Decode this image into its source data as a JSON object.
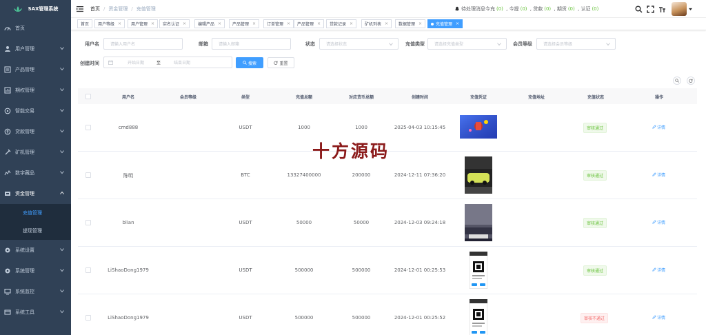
{
  "app": {
    "title": "SAX管理系统"
  },
  "sidebar": {
    "items": [
      {
        "label": "首页",
        "icon": "dashboard-icon"
      },
      {
        "label": "用户管理",
        "icon": "user-icon"
      },
      {
        "label": "产品管理",
        "icon": "product-icon"
      },
      {
        "label": "期权管理",
        "icon": "option-icon"
      },
      {
        "label": "智能交易",
        "icon": "smart-trade-icon"
      },
      {
        "label": "贷款管理",
        "icon": "loan-icon"
      },
      {
        "label": "矿机管理",
        "icon": "miner-icon"
      },
      {
        "label": "数字藏品",
        "icon": "collection-icon"
      },
      {
        "label": "资金管理",
        "icon": "money-icon"
      },
      {
        "label": "系统设置",
        "icon": "settings-icon"
      },
      {
        "label": "系统管理",
        "icon": "system-icon"
      },
      {
        "label": "系统监控",
        "icon": "monitor-icon"
      },
      {
        "label": "系统工具",
        "icon": "tool-icon"
      }
    ],
    "sub_items": [
      "充值管理",
      "提现管理"
    ]
  },
  "breadcrumb": {
    "home": "首页",
    "parent": "资金管理",
    "current": "充值管理"
  },
  "notice": {
    "pending": "待处理消息",
    "recharge_label": "今充",
    "recharge_count": "(0)",
    "withdraw_label": "今提",
    "withdraw_count": "(0)",
    "loan_label": "贷款",
    "loan_count": "(0)",
    "futures_label": "期货",
    "futures_count": "(0)",
    "verify_label": "认证",
    "verify_count": "(0)"
  },
  "tabs": [
    {
      "label": "首页"
    },
    {
      "label": "用户等级"
    },
    {
      "label": "用户管理"
    },
    {
      "label": "实名认证"
    },
    {
      "label": "编辑产品"
    },
    {
      "label": "产品管理"
    },
    {
      "label": "订单管理"
    },
    {
      "label": "产品管理"
    },
    {
      "label": "贷款记录"
    },
    {
      "label": "矿机列表"
    },
    {
      "label": "数据管理"
    },
    {
      "label": "充值管理"
    }
  ],
  "filters": {
    "username_label": "用户名",
    "username_placeholder": "请输入用户名",
    "email_label": "邮箱",
    "email_placeholder": "请输入邮箱",
    "status_label": "状态",
    "status_placeholder": "请选择状态",
    "type_label": "充值类型",
    "type_placeholder": "请选择充值类型",
    "level_label": "会员等级",
    "level_placeholder": "请选择会员等级",
    "time_label": "创建时间",
    "start_placeholder": "开始日期",
    "range_sep": "至",
    "end_placeholder": "结束日期",
    "search_btn": "搜索",
    "reset_btn": "重置"
  },
  "table": {
    "headers": [
      "用户名",
      "会员等级",
      "类型",
      "充值总额",
      "对应货币总额",
      "创建时间",
      "充值凭证",
      "充值地址",
      "充值状态",
      "操作"
    ],
    "rows": [
      {
        "username": "cmd888",
        "level": "",
        "type": "USDT",
        "amount": "1000",
        "currency_amount": "1000",
        "time": "2025-04-03 10:15:45",
        "address": "",
        "status": "审核通过",
        "status_kind": "ok",
        "action": "详情",
        "thumb": "gift"
      },
      {
        "username": "陈明",
        "level": "",
        "type": "BTC",
        "amount": "13327400000",
        "currency_amount": "200000",
        "time": "2024-12-11 07:36:20",
        "address": "",
        "status": "审核通过",
        "status_kind": "ok",
        "action": "详情",
        "thumb": "car"
      },
      {
        "username": "blian",
        "level": "",
        "type": "USDT",
        "amount": "50000",
        "currency_amount": "50000",
        "time": "2024-12-03 09:24:18",
        "address": "",
        "status": "审核通过",
        "status_kind": "ok",
        "action": "详情",
        "thumb": "street"
      },
      {
        "username": "LiShaoDong1979",
        "level": "",
        "type": "USDT",
        "amount": "500000",
        "currency_amount": "500000",
        "time": "2024-12-01 00:25:53",
        "address": "",
        "status": "审核通过",
        "status_kind": "ok",
        "action": "详情",
        "thumb": "phone"
      },
      {
        "username": "LiShaoDong1979",
        "level": "",
        "type": "USDT",
        "amount": "500000",
        "currency_amount": "500000",
        "time": "2024-12-01 00:25:52",
        "address": "",
        "status": "审核不通过",
        "status_kind": "bad",
        "action": "详情",
        "thumb": "phone"
      }
    ]
  },
  "watermark": "十方源码",
  "colors": {
    "sidebar_bg": "#304156",
    "primary": "#409eff",
    "success": "#67c23a",
    "danger": "#f56c6c"
  }
}
